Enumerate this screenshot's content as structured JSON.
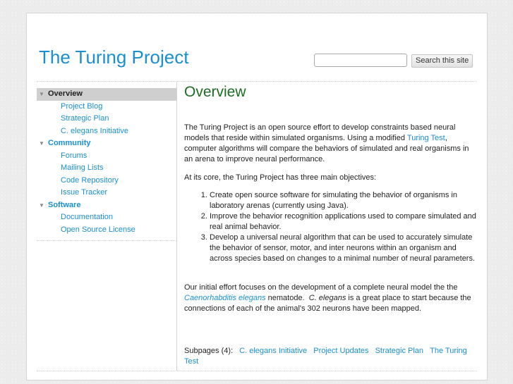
{
  "header": {
    "site_title": "The Turing Project",
    "search_placeholder": "",
    "search_button": "Search this site"
  },
  "sidebar": {
    "sections": [
      {
        "label": "Overview",
        "active": true,
        "children": [
          "Project Blog",
          "Strategic Plan",
          "C. elegans Initiative"
        ]
      },
      {
        "label": "Community",
        "active": false,
        "children": [
          "Forums",
          "Mailing Lists",
          "Code Repository",
          "Issue Tracker"
        ]
      },
      {
        "label": "Software",
        "active": false,
        "children": [
          "Documentation",
          "Open Source License"
        ]
      }
    ]
  },
  "content": {
    "title": "Overview",
    "p1_before": "The Turing Project is an open source effort to develop constraints based neural models that reside within simulated organisms. Using a modified ",
    "p1_link": "Turing Test",
    "p1_after": ", computer algorithms will compare the behaviors of simulated and real organisms in an arena to improve neural performance.",
    "p2": "At its core, the Turing Project has three main objectives:",
    "objectives": [
      "Create open source software for simulating the behavior of organisms in laboratory arenas (currently using Java).",
      "Improve the behavior recognition applications used to compare simulated and real animal behavior.",
      "Develop a universal neural algorithm that can be used to accurately simulate the behavior of sensor, motor, and inter neurons within an organism and across species based on changes to a minimal number of neural parameters."
    ],
    "p3_a": "Our initial effort focuses on the development of a complete neural model the the ",
    "p3_link": "Caenorhabditis elegans",
    "p3_b": " nematode.  ",
    "p3_em": "C. elegans",
    "p3_c": " is a great place to start because the connections of each of the animal's 302 neurons have been mapped.",
    "subpages_label": "Subpages (4):",
    "subpages": [
      "C. elegans Initiative",
      "Project Updates",
      "Strategic Plan",
      "The Turing Test"
    ]
  }
}
